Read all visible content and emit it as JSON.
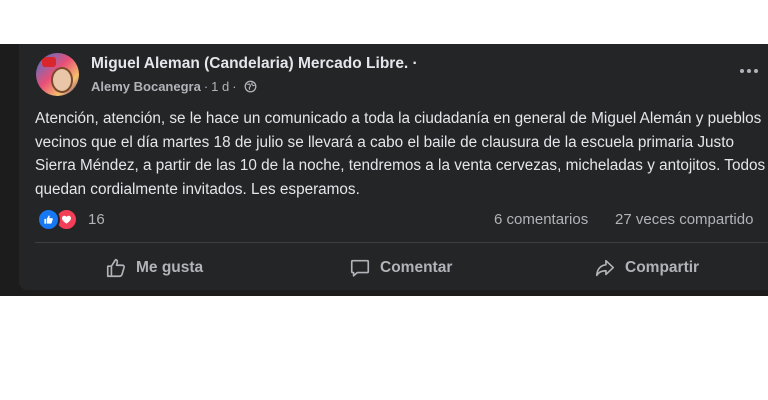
{
  "post": {
    "group_name": "Miguel Aleman (Candelaria) Mercado Libre.",
    "group_suffix": " ·",
    "author": "Alemy Bocanegra",
    "time": "1 d",
    "body": "Atención, atención, se le hace un comunicado a toda la ciudadanía en general de Miguel Alemán y pueblos vecinos que el día martes 18 de julio se llevará a cabo el baile de clausura de la escuela primaria Justo Sierra Méndez, a partir de las 10 de la noche, tendremos a la venta cervezas, micheladas y antojitos. Todos quedan cordialmente invitados. Les esperamos.",
    "privacy_icon": "globe-icon"
  },
  "stats": {
    "reaction_count": "16",
    "reaction_icons": [
      "like-reaction-icon",
      "love-reaction-icon"
    ],
    "comments": "6 comentarios",
    "shares": "27 veces compartido"
  },
  "actions": {
    "like": "Me gusta",
    "comment": "Comentar",
    "share": "Compartir"
  },
  "colors": {
    "card_background": "#242526",
    "text_primary": "#e4e6eb",
    "text_secondary": "#b0b3b8",
    "like_blue": "#1877f2",
    "love_red": "#f33e58"
  }
}
